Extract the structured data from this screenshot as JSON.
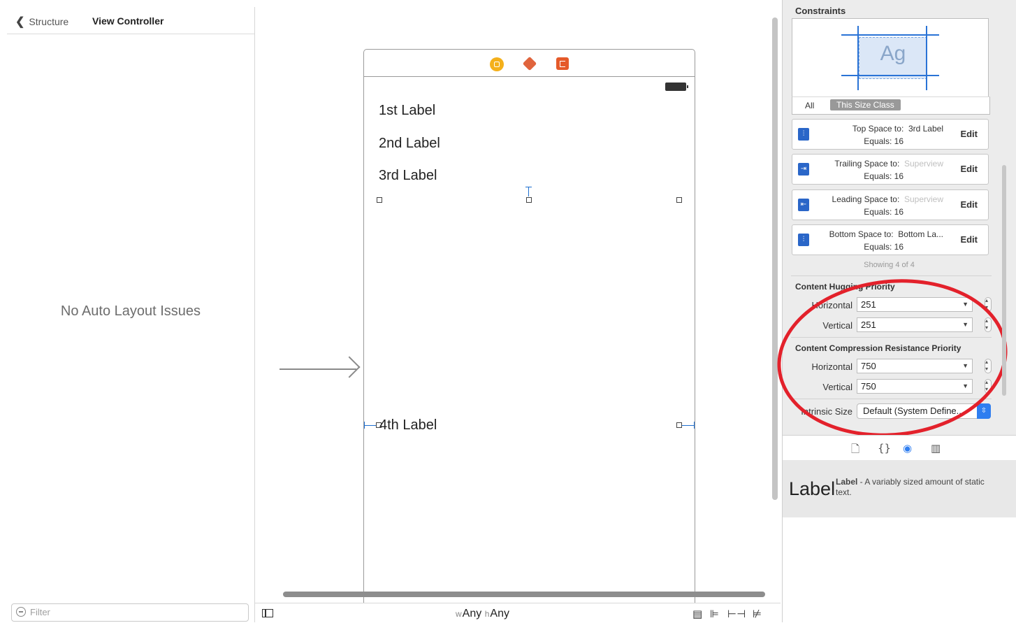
{
  "navigator": {
    "back_label": "Structure",
    "current_label": "View Controller",
    "empty_message": "No Auto Layout Issues",
    "filter_placeholder": "Filter"
  },
  "canvas": {
    "labels": [
      "1st Label",
      "2nd Label",
      "3rd Label",
      "4th Label"
    ],
    "size_class_w_prefix": "w",
    "size_class_w": "Any",
    "size_class_h_prefix": "h",
    "size_class_h": "Any"
  },
  "inspector": {
    "section_title": "Constraints",
    "preview_text": "Ag",
    "scope_all": "All",
    "scope_size_class": "This Size Class",
    "constraints": [
      {
        "icon": "top-space-icon",
        "line1_prefix": "Top Space to:",
        "line1_target": "3rd Label",
        "target_faint": false,
        "line2": "Equals:  16",
        "edit": "Edit"
      },
      {
        "icon": "trailing-space-icon",
        "line1_prefix": "Trailing Space to:",
        "line1_target": "Superview",
        "target_faint": true,
        "line2": "Equals:  16",
        "edit": "Edit"
      },
      {
        "icon": "leading-space-icon",
        "line1_prefix": "Leading Space to:",
        "line1_target": "Superview",
        "target_faint": true,
        "line2": "Equals:  16",
        "edit": "Edit"
      },
      {
        "icon": "bottom-space-icon",
        "line1_prefix": "Bottom Space to:",
        "line1_target": "Bottom La...",
        "target_faint": false,
        "line2": "Equals:  16",
        "edit": "Edit"
      }
    ],
    "showing": "Showing 4 of 4",
    "hugging_title": "Content Hugging Priority",
    "hugging_horizontal_label": "Horizontal",
    "hugging_horizontal": "251",
    "hugging_vertical_label": "Vertical",
    "hugging_vertical": "251",
    "compression_title": "Content Compression Resistance Priority",
    "compression_horizontal_label": "Horizontal",
    "compression_horizontal": "750",
    "compression_vertical_label": "Vertical",
    "compression_vertical": "750",
    "intrinsic_label": "Intrinsic Size",
    "intrinsic_value": "Default (System Define...",
    "annotation_color": "#e3212b"
  },
  "library": {
    "big_label": "Label",
    "title": "Label",
    "description": " - A variably sized amount of static text."
  }
}
